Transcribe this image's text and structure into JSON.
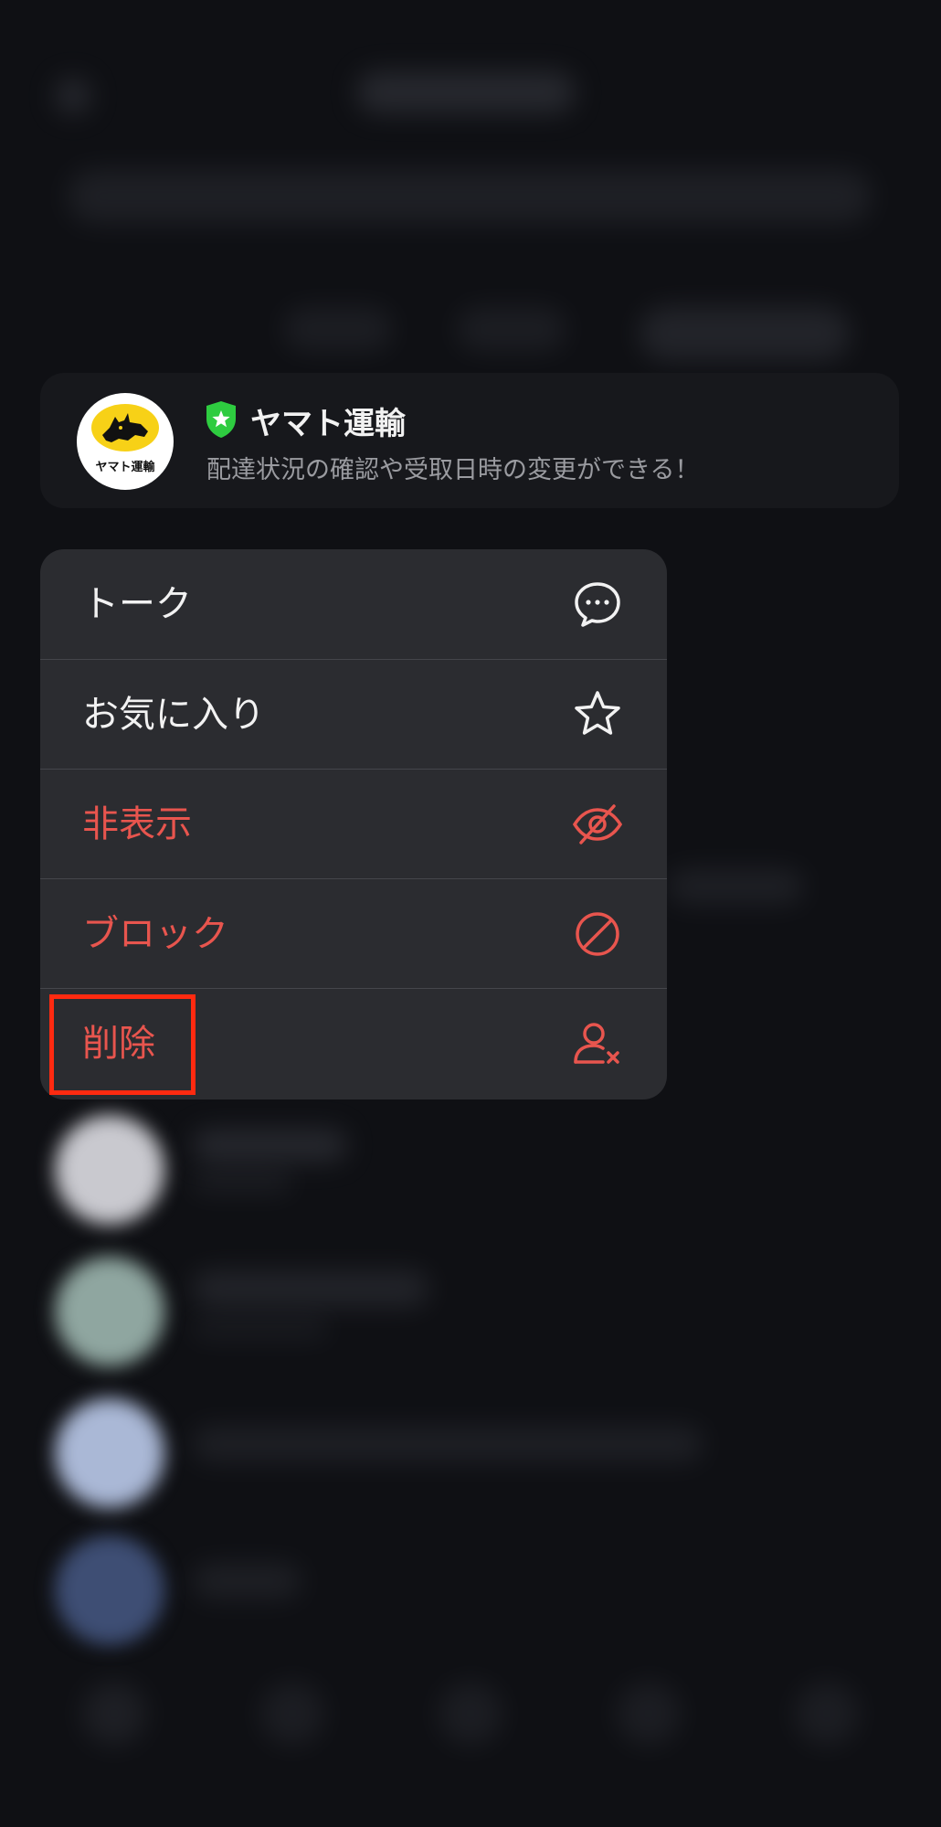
{
  "preview": {
    "name": "ヤマト運輸",
    "description": "配達状況の確認や受取日時の変更ができる！",
    "logo_text": "ヤマト運輸",
    "badge_icon": "verified-shield-icon",
    "badge_color": "#2ecc40",
    "logo_color": "#f7d117"
  },
  "menu": {
    "items": [
      {
        "label": "トーク",
        "icon": "chat-bubble-icon",
        "style": "normal"
      },
      {
        "label": "お気に入り",
        "icon": "star-icon",
        "style": "normal"
      },
      {
        "label": "非表示",
        "icon": "eye-slash-icon",
        "style": "danger"
      },
      {
        "label": "ブロック",
        "icon": "block-icon",
        "style": "danger"
      },
      {
        "label": "削除",
        "icon": "remove-user-icon",
        "style": "danger"
      }
    ]
  },
  "colors": {
    "background": "#0f1014",
    "menu_background": "#2b2c30",
    "danger": "#e8554e",
    "highlight": "#ff2a10"
  }
}
